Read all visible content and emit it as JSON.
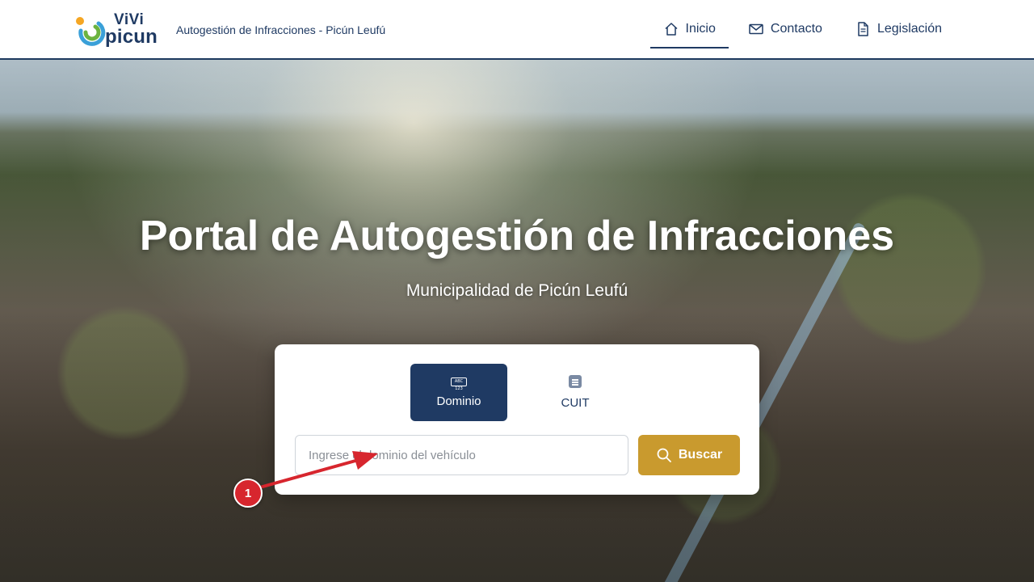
{
  "header": {
    "logo": {
      "line1": "ViVi",
      "line2": "picun",
      "dot_colors": [
        "#f5a623",
        "#3aa0d8",
        "#6cb33f"
      ]
    },
    "site_title": "Autogestión de Infracciones - Picún Leufú",
    "nav": [
      {
        "label": "Inicio",
        "icon": "home-icon",
        "active": true
      },
      {
        "label": "Contacto",
        "icon": "envelope-icon",
        "active": false
      },
      {
        "label": "Legislación",
        "icon": "document-icon",
        "active": false
      }
    ]
  },
  "hero": {
    "title": "Portal de Autogestión de Infracciones",
    "subtitle": "Municipalidad de Picún Leufú"
  },
  "search_card": {
    "tabs": [
      {
        "label": "Dominio",
        "icon": "license-plate-icon",
        "icon_text": "ABC 123",
        "active": true
      },
      {
        "label": "CUIT",
        "icon": "id-document-icon",
        "active": false
      }
    ],
    "input_placeholder": "Ingrese el dominio del vehículo",
    "input_value": "",
    "button_label": "Buscar"
  },
  "annotation": {
    "step_number": "1",
    "color": "#d7262e"
  },
  "colors": {
    "primary": "#1f3a63",
    "accent": "#c99a2e"
  }
}
